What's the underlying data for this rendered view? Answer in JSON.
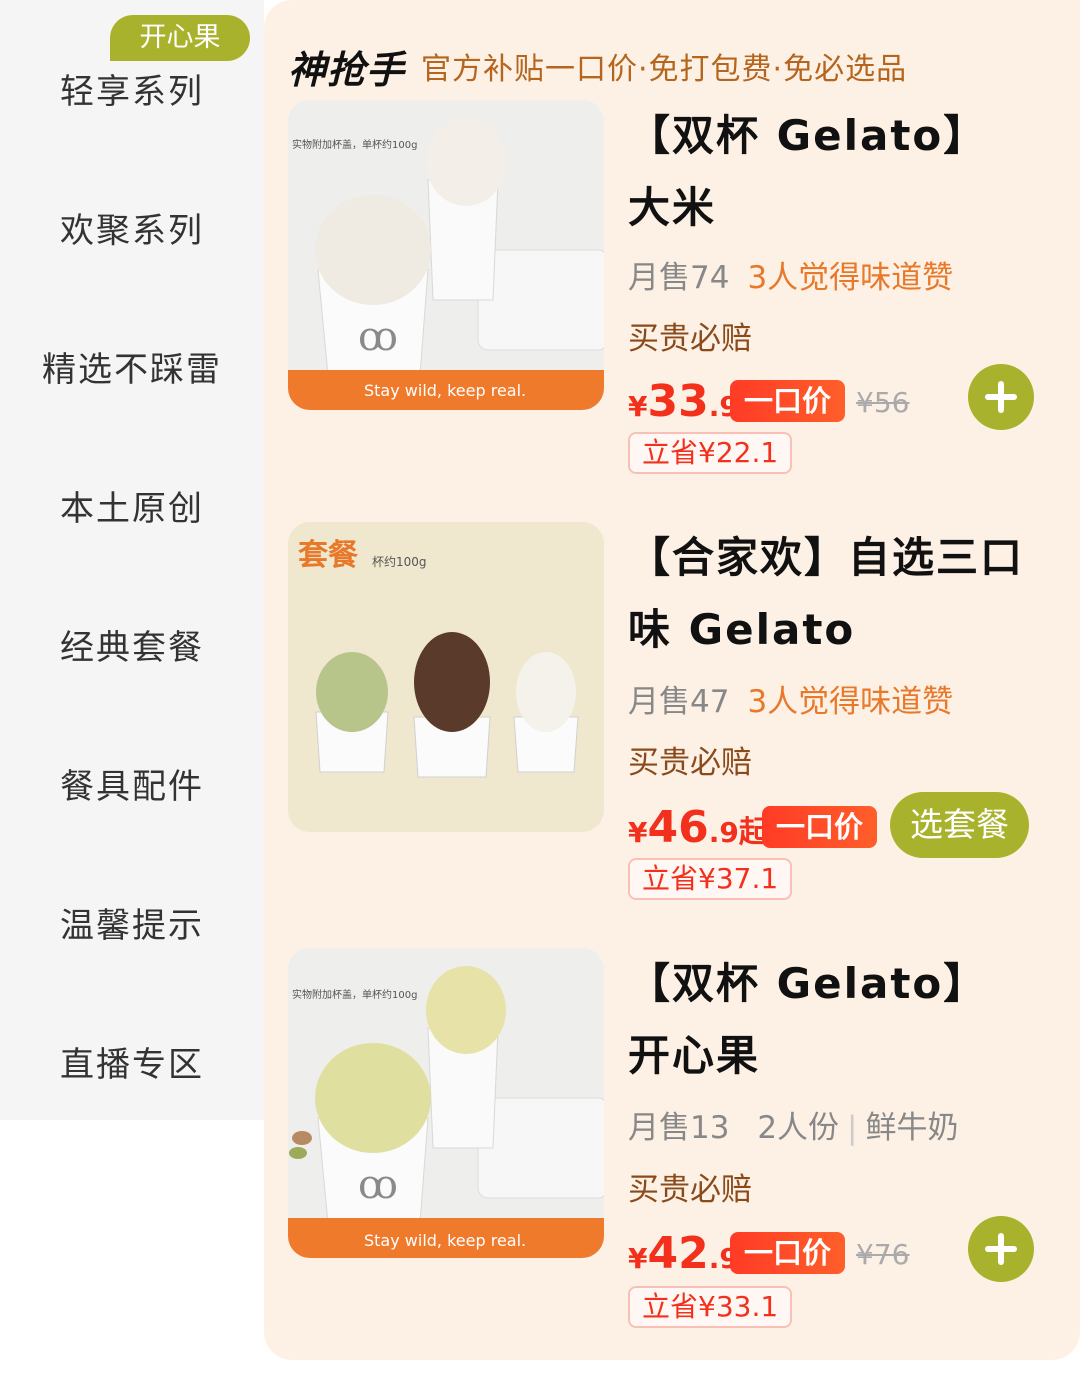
{
  "sidebar": {
    "badge": "开心果",
    "items": [
      {
        "label": "轻享系列"
      },
      {
        "label": "欢聚系列"
      },
      {
        "label": "精选不踩雷"
      },
      {
        "label": "本土原创"
      },
      {
        "label": "经典套餐"
      },
      {
        "label": "餐具配件"
      },
      {
        "label": "温馨提示"
      },
      {
        "label": "直播专区"
      }
    ]
  },
  "header": {
    "brand": "神抢手",
    "subtitle": "官方补贴一口价·免打包费·免必选品"
  },
  "products": [
    {
      "title": "【双杯 Gelato】大米",
      "monthly_sales": "月售74",
      "praise": "3人觉得味道赞",
      "guarantee": "买贵必赔",
      "price_yen": "¥",
      "price_int": "33",
      "price_dec": ".9",
      "fixed_badge": "一口价",
      "orig_price": "¥56",
      "save": "立省¥22.1",
      "image_caption": "Stay wild, keep real.",
      "image_note": "实物附加杯盖，单杯约100g",
      "action_icon": "plus-icon"
    },
    {
      "title": "【合家欢】自选三口味 Gelato",
      "monthly_sales": "月售47",
      "praise": "3人觉得味道赞",
      "guarantee": "买贵必赔",
      "price_yen": "¥",
      "price_int": "46",
      "price_dec": ".9",
      "price_suffix": "起",
      "fixed_badge": "一口价",
      "save": "立省¥37.1",
      "set_tag": "套餐",
      "image_note": "杯约100g",
      "action_label": "选套餐"
    },
    {
      "title": "【双杯 Gelato】开心果",
      "monthly_sales": "月售13",
      "serving": "2人份",
      "ingredient": "鲜牛奶",
      "guarantee": "买贵必赔",
      "price_yen": "¥",
      "price_int": "42",
      "price_dec": ".9",
      "fixed_badge": "一口价",
      "orig_price": "¥76",
      "save": "立省¥33.1",
      "image_caption": "Stay wild, keep real.",
      "image_note": "实物附加杯盖，单杯约100g",
      "action_icon": "plus-icon"
    }
  ],
  "colors": {
    "accent_green": "#a9b22c",
    "price_red": "#f2301c",
    "praise_orange": "#e8792b",
    "panel_bg": "#fdf1e6"
  }
}
